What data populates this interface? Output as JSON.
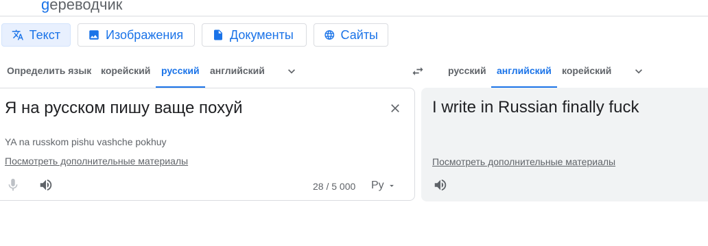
{
  "header": {
    "logo_g": "g",
    "logo_rest": "ереводчик"
  },
  "modes": [
    {
      "label": "Текст",
      "icon": "translate-icon",
      "active": true
    },
    {
      "label": "Изображения",
      "icon": "image-icon",
      "active": false
    },
    {
      "label": "Документы",
      "icon": "document-icon",
      "active": false
    },
    {
      "label": "Сайты",
      "icon": "globe-icon",
      "active": false
    }
  ],
  "source_langs": [
    "Определить язык",
    "корейский",
    "русский",
    "английский"
  ],
  "source_active": "русский",
  "target_langs": [
    "русский",
    "английский",
    "корейский"
  ],
  "target_active": "английский",
  "source": {
    "text": "Я на русском пишу ваще похуй",
    "transliteration": "YA na russkom pishu vashche pokhuy",
    "more_link": "Посмотреть дополнительные материалы",
    "counter": "28 / 5 000",
    "keyboard_label": "Ру"
  },
  "target": {
    "text": "I write in Russian finally fuck",
    "more_link": "Посмотреть дополнительные материалы"
  },
  "colors": {
    "accent": "#1a73e8",
    "muted": "#5f6368",
    "target_bg": "#f1f3f4",
    "active_tab_bg": "#e8f0fe"
  }
}
